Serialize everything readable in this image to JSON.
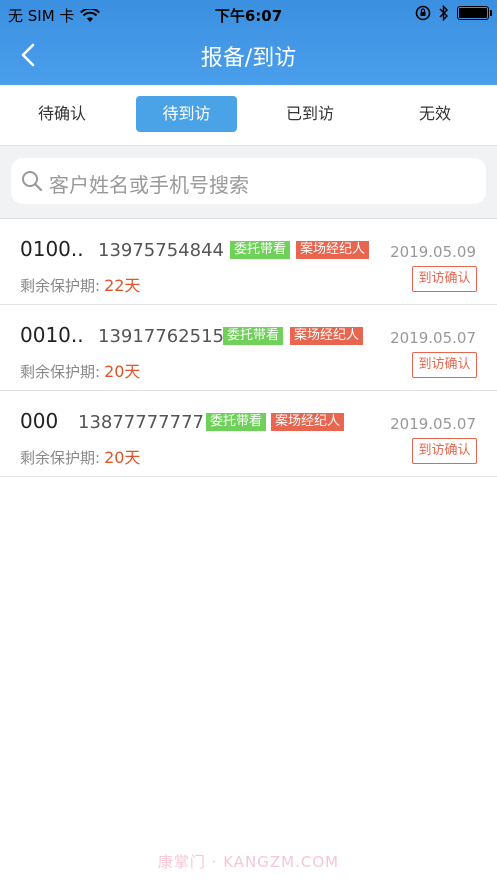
{
  "status_bar": {
    "carrier": "无 SIM 卡",
    "time": "下午6:07"
  },
  "nav": {
    "title": "报备/到访"
  },
  "tabs": [
    {
      "label": "待确认",
      "active": false
    },
    {
      "label": "待到访",
      "active": true
    },
    {
      "label": "已到访",
      "active": false
    },
    {
      "label": "无效",
      "active": false
    }
  ],
  "search": {
    "placeholder": "客户姓名或手机号搜索"
  },
  "records": [
    {
      "name": "0100..",
      "phone": "13975754844",
      "tag1": "委托带看",
      "tag2": "案场经纪人",
      "date": "2019.05.09",
      "protect_label": "剩余保护期:",
      "days": "22天",
      "button": "到访确认"
    },
    {
      "name": "0010..",
      "phone": "13917762515",
      "tag1": "委托带看",
      "tag2": "案场经纪人",
      "date": "2019.05.07",
      "protect_label": "剩余保护期:",
      "days": "20天",
      "button": "到访确认"
    },
    {
      "name": "000",
      "phone": "13877777777",
      "tag1": "委托带看",
      "tag2": "案场经纪人",
      "date": "2019.05.07",
      "protect_label": "剩余保护期:",
      "days": "20天",
      "button": "到访确认"
    }
  ],
  "watermark": "康掌门 · KANGZM.COM",
  "colors": {
    "header": "#3b8fe0",
    "active_tab": "#4aa3e6",
    "tag_green": "#6fd05a",
    "tag_red": "#e8664f",
    "days_red": "#e2532a"
  }
}
